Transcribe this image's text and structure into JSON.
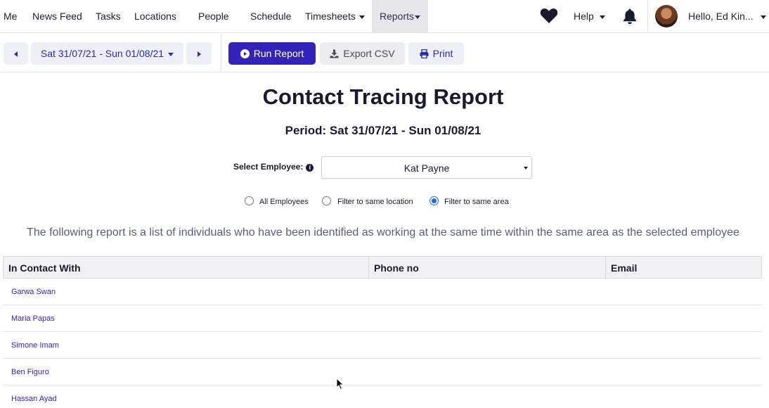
{
  "nav": {
    "items": [
      {
        "label": "Me"
      },
      {
        "label": "News Feed"
      },
      {
        "label": "Tasks"
      },
      {
        "label": "Locations"
      },
      {
        "label": "People"
      },
      {
        "label": "Schedule"
      },
      {
        "label": "Timesheets"
      },
      {
        "label": "Reports"
      }
    ],
    "help_label": "Help",
    "user_greeting": "Hello, Ed Kin..."
  },
  "toolbar": {
    "date_range": "Sat 31/07/21 - Sun 01/08/21",
    "run_label": "Run Report",
    "export_label": "Export CSV",
    "print_label": "Print"
  },
  "report": {
    "title": "Contact Tracing Report",
    "period": "Period: Sat 31/07/21 - Sun 01/08/21",
    "select_label": "Select Employee:",
    "selected_employee": "Kat Payne",
    "filters": [
      {
        "label": "All Employees",
        "checked": false
      },
      {
        "label": "Filter to same location",
        "checked": false
      },
      {
        "label": "Filter to same area",
        "checked": true
      }
    ],
    "description": "The following report is a list of individuals who have been identified as working at the same time within the same area as the selected employee"
  },
  "table": {
    "columns": [
      "In Contact With",
      "Phone no",
      "Email"
    ],
    "rows": [
      {
        "name": "Garwa Swan",
        "phone": "",
        "email": ""
      },
      {
        "name": "Maria Papas",
        "phone": "",
        "email": ""
      },
      {
        "name": "Simone Imam",
        "phone": "",
        "email": ""
      },
      {
        "name": "Ben Figuro",
        "phone": "",
        "email": ""
      },
      {
        "name": "Hassan Ayad",
        "phone": "",
        "email": ""
      }
    ]
  },
  "colors": {
    "accent": "#3423b8",
    "radio_checked": "#1a6fe0"
  }
}
